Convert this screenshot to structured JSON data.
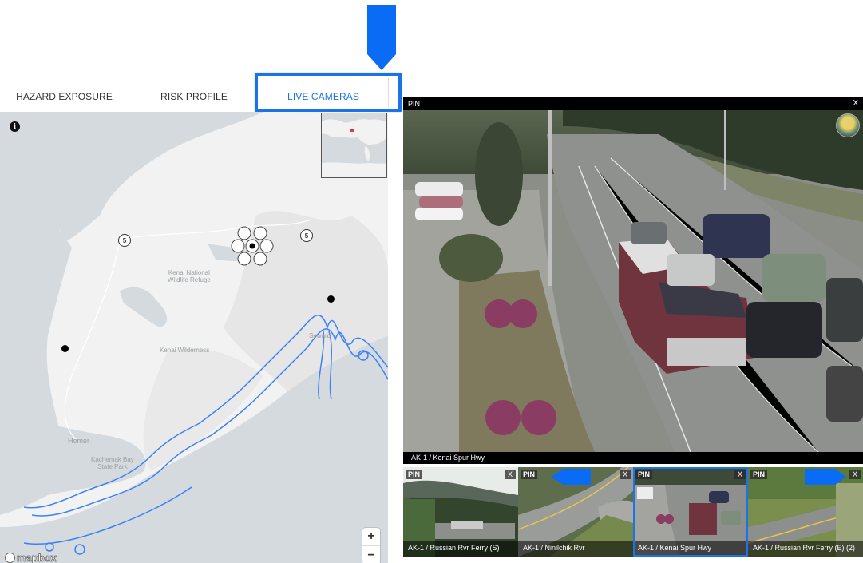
{
  "tabs": [
    {
      "label": "HAZARD EXPOSURE",
      "active": false
    },
    {
      "label": "RISK PROFILE",
      "active": false
    },
    {
      "label": "LIVE CAMERAS",
      "active": true
    }
  ],
  "colors": {
    "accent": "#1a73e8",
    "annotation_arrow": "#0a6cf5",
    "water": "#d4dadd",
    "land": "#f2f2f2",
    "hazard_outline": "#3b82f6"
  },
  "map": {
    "icons": {
      "info": "info-icon",
      "zoom_in": "plus-icon",
      "zoom_out": "minus-icon"
    },
    "labels": [
      {
        "text": "Kenai National\nWildlife Refuge"
      },
      {
        "text": "Kenai Wilderness"
      },
      {
        "text": "Homer"
      },
      {
        "text": "Kachemak Bay\nState Park"
      },
      {
        "text": "Seward"
      }
    ],
    "clusters": [
      {
        "count": "5"
      },
      {
        "count": "5"
      }
    ],
    "zoom_in_label": "+",
    "zoom_out_label": "−",
    "attribution": "mapbox"
  },
  "main_camera": {
    "pin_label": "PIN",
    "close_label": "X",
    "caption": "AK-1 / Kenai Spur Hwy"
  },
  "thumbnails": [
    {
      "pin_label": "PIN",
      "close_label": "X",
      "caption": "AK-1 / Russian Rvr Ferry (S)",
      "selected": false
    },
    {
      "pin_label": "PIN",
      "close_label": "X",
      "caption": "AK-1 / Ninilchik Rvr",
      "selected": false
    },
    {
      "pin_label": "PIN",
      "close_label": "X",
      "caption": "AK-1 / Kenai Spur Hwy",
      "selected": true
    },
    {
      "pin_label": "PIN",
      "close_label": "X",
      "caption": "AK-1 / Russian Rvr Ferry (E) (2)",
      "selected": false
    }
  ]
}
